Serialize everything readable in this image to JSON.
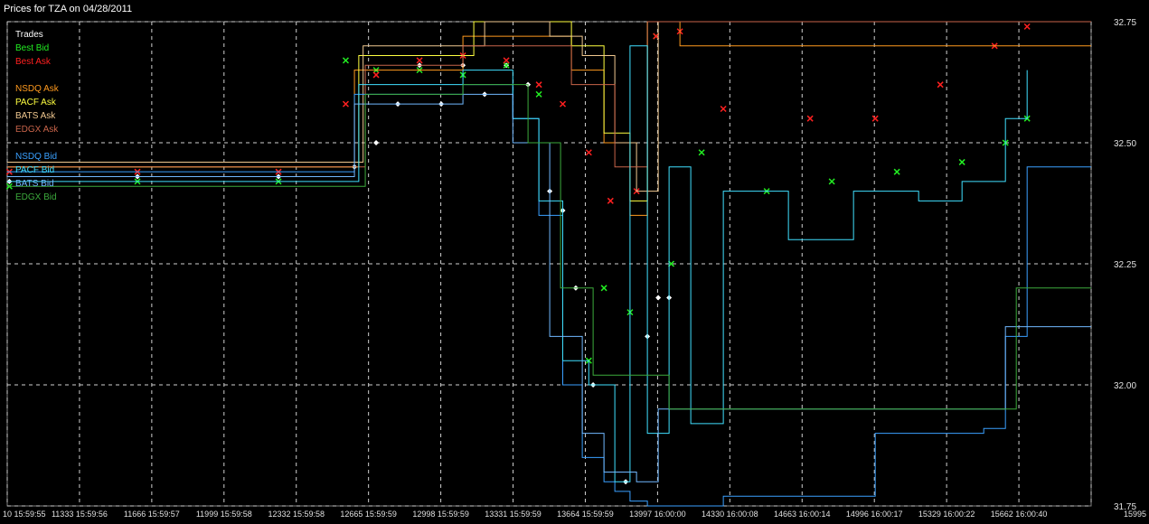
{
  "chart_data": {
    "type": "line",
    "title": "Prices for TZA on 04/28/2011",
    "ylim": [
      31.75,
      32.75
    ],
    "yticks": [
      "32.75",
      "32.50",
      "32.25",
      "32.00",
      "31.75"
    ],
    "yvalues": [
      32.75,
      32.5,
      32.25,
      32.0,
      31.75
    ],
    "xticks": [
      "10 15:59:55",
      "11333 15:59:56",
      "11666 15:59:57",
      "11999 15:59:58",
      "12332 15:59:58",
      "12665 15:59:59",
      "12998 15:59:59",
      "13331 15:59:59",
      "13664 15:59:59",
      "13997 16:00:00",
      "14330 16:00:08",
      "14663 16:00:14",
      "14996 16:00:17",
      "15329 16:00:22",
      "15662 16:00:40",
      "15995"
    ],
    "xrange": [
      11000,
      15995
    ],
    "grid": true,
    "legend_position": "top-left",
    "legend": [
      {
        "name": "Trades",
        "color": "#ffffff",
        "marker": "diamond"
      },
      {
        "name": "Best Bid",
        "color": "#22ee22",
        "marker": "x"
      },
      {
        "name": "Best Ask",
        "color": "#ff2020",
        "marker": "x"
      },
      {
        "name": "",
        "color": "#000000"
      },
      {
        "name": "NSDQ Ask",
        "color": "#ff9a1e"
      },
      {
        "name": "PACF Ask",
        "color": "#ffff40"
      },
      {
        "name": "BATS Ask",
        "color": "#f0c890"
      },
      {
        "name": "EDGX Ask",
        "color": "#c8644a"
      },
      {
        "name": "",
        "color": "#000000"
      },
      {
        "name": "NSDQ Bid",
        "color": "#3aa0ff"
      },
      {
        "name": "PACF Bid",
        "color": "#40e0ff"
      },
      {
        "name": "BATS Bid",
        "color": "#70b8ff"
      },
      {
        "name": "EDGX Bid",
        "color": "#3caa3c"
      }
    ],
    "series": [
      {
        "name": "Trades",
        "color": "#ffffff",
        "style": "markers",
        "x": [
          11010,
          11600,
          12250,
          12600,
          12700,
          12800,
          12900,
          13000,
          13100,
          13200,
          13300,
          13400,
          13500,
          13560,
          13620,
          13700,
          13850,
          13950,
          14000,
          14050
        ],
        "y": [
          32.42,
          32.43,
          32.43,
          32.45,
          32.5,
          32.58,
          32.66,
          32.58,
          32.66,
          32.6,
          32.66,
          32.62,
          32.4,
          32.36,
          32.2,
          32.0,
          31.8,
          32.1,
          32.18,
          32.18
        ]
      },
      {
        "name": "Best Bid",
        "color": "#22ee22",
        "style": "markers",
        "x": [
          11010,
          11600,
          12250,
          12560,
          12700,
          12900,
          13100,
          13300,
          13450,
          13680,
          13750,
          13870,
          13990,
          14060,
          14200,
          14500,
          14800,
          15100,
          15400,
          15600,
          15700
        ],
        "y": [
          32.41,
          32.42,
          32.42,
          32.67,
          32.65,
          32.65,
          32.64,
          32.66,
          32.6,
          32.05,
          32.2,
          32.15,
          32.72,
          32.25,
          32.48,
          32.4,
          32.42,
          32.44,
          32.46,
          32.5,
          32.55
        ]
      },
      {
        "name": "Best Ask",
        "color": "#ff2020",
        "style": "markers",
        "x": [
          11010,
          11600,
          12250,
          12560,
          12700,
          12900,
          13100,
          13300,
          13450,
          13560,
          13680,
          13780,
          13900,
          13990,
          14100,
          14300,
          14700,
          15000,
          15300,
          15550,
          15700
        ],
        "y": [
          32.44,
          32.44,
          32.44,
          32.58,
          32.64,
          32.67,
          32.68,
          32.67,
          32.62,
          32.58,
          32.48,
          32.38,
          32.4,
          32.72,
          32.73,
          32.57,
          32.55,
          32.55,
          32.62,
          32.7,
          32.74
        ]
      },
      {
        "name": "NSDQ Ask",
        "color": "#ff9a1e",
        "style": "line",
        "x": [
          11000,
          12560,
          12600,
          13100,
          13450,
          13600,
          13750,
          13870,
          13950,
          14000,
          14100,
          15995
        ],
        "y": [
          32.45,
          32.45,
          32.65,
          32.72,
          32.72,
          32.65,
          32.5,
          32.35,
          32.75,
          32.75,
          32.7,
          32.7
        ]
      },
      {
        "name": "PACF Ask",
        "color": "#ffff40",
        "style": "line",
        "x": [
          11000,
          12560,
          12620,
          13150,
          13450,
          13600,
          13750,
          13870,
          13950,
          14050,
          14250,
          15995
        ],
        "y": [
          32.45,
          32.45,
          32.68,
          32.75,
          32.75,
          32.7,
          32.52,
          32.38,
          32.75,
          32.75,
          32.75,
          32.75
        ]
      },
      {
        "name": "BATS Ask",
        "color": "#f0c890",
        "style": "line",
        "x": [
          11000,
          12560,
          12640,
          13200,
          13500,
          13650,
          13800,
          13900,
          14000,
          14100,
          15995
        ],
        "y": [
          32.46,
          32.46,
          32.7,
          32.75,
          32.72,
          32.68,
          32.5,
          32.4,
          32.75,
          32.75,
          32.75
        ]
      },
      {
        "name": "EDGX Ask",
        "color": "#c8644a",
        "style": "line",
        "x": [
          11000,
          12560,
          12650,
          13100,
          13450,
          13600,
          13800,
          13950,
          14050,
          15995
        ],
        "y": [
          32.45,
          32.45,
          32.66,
          32.7,
          32.7,
          32.62,
          32.45,
          32.75,
          32.75,
          32.75
        ]
      },
      {
        "name": "NSDQ Bid",
        "color": "#3aa0ff",
        "style": "line",
        "x": [
          11000,
          12560,
          12600,
          13100,
          13330,
          13450,
          13560,
          13650,
          13750,
          13800,
          13870,
          13950,
          14100,
          14300,
          15000,
          15500,
          15600,
          15700,
          15995
        ],
        "y": [
          32.44,
          32.44,
          32.6,
          32.62,
          32.55,
          32.35,
          32.0,
          31.85,
          31.8,
          31.78,
          31.76,
          31.75,
          31.75,
          31.77,
          31.9,
          31.91,
          32.1,
          32.45,
          32.45
        ]
      },
      {
        "name": "PACF Bid",
        "color": "#40e0ff",
        "style": "line",
        "x": [
          11000,
          12560,
          12620,
          13100,
          13330,
          13450,
          13560,
          13680,
          13800,
          13870,
          13950,
          14050,
          14150,
          14300,
          14600,
          14900,
          15200,
          15400,
          15600,
          15700
        ],
        "y": [
          32.42,
          32.42,
          32.62,
          32.65,
          32.55,
          32.38,
          32.05,
          32.0,
          31.8,
          32.7,
          31.9,
          32.45,
          31.92,
          32.4,
          32.3,
          32.4,
          32.38,
          32.42,
          32.55,
          32.65
        ]
      },
      {
        "name": "BATS Bid",
        "color": "#70b8ff",
        "style": "line",
        "x": [
          11000,
          12560,
          12600,
          13100,
          13330,
          13500,
          13650,
          13750,
          13900,
          14000,
          14100,
          15500,
          15600,
          15995
        ],
        "y": [
          32.43,
          32.43,
          32.58,
          32.6,
          32.5,
          32.1,
          31.9,
          31.82,
          31.8,
          31.95,
          31.95,
          31.95,
          32.12,
          32.12
        ]
      },
      {
        "name": "EDGX Bid",
        "color": "#3caa3c",
        "style": "line",
        "x": [
          11000,
          12560,
          12650,
          13100,
          13400,
          13550,
          13700,
          13900,
          14050,
          14200,
          15400,
          15650,
          15995
        ],
        "y": [
          32.41,
          32.41,
          32.6,
          32.62,
          32.5,
          32.2,
          32.02,
          32.02,
          31.95,
          31.95,
          31.95,
          32.2,
          32.2
        ]
      }
    ]
  }
}
